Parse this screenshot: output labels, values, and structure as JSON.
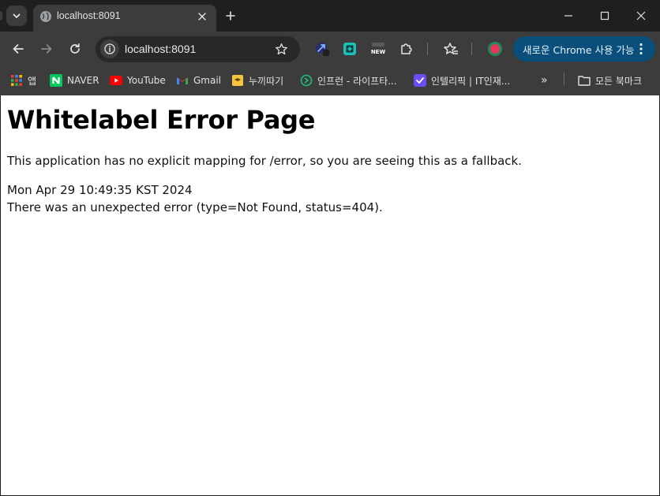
{
  "browser": {
    "tab": {
      "title": "localhost:8091"
    },
    "omnibox": {
      "url": "localhost:8091"
    },
    "update_button": {
      "label": "새로운 Chrome 사용 가능"
    },
    "bookmarks": [
      {
        "label": "앱",
        "icon": "apps-grid-icon"
      },
      {
        "label": "NAVER",
        "icon": "naver-icon"
      },
      {
        "label": "YouTube",
        "icon": "youtube-icon"
      },
      {
        "label": "Gmail",
        "icon": "gmail-icon"
      },
      {
        "label": "누끼따기",
        "icon": "folder-yellow-icon"
      },
      {
        "label": "인프런 - 라이프타...",
        "icon": "inflearn-icon"
      },
      {
        "label": "인텔리픽 | IT인재...",
        "icon": "check-purple-icon"
      }
    ],
    "bookmarks_overflow": "»",
    "all_bookmarks": {
      "label": "모든 북마크",
      "icon": "folder-icon"
    },
    "colors": {
      "chrome_dark": "#1f1f1f",
      "toolbar": "#3c3c3c",
      "update_blue": "#0a4f7c",
      "page_bg": "#ffffff"
    }
  },
  "page": {
    "heading": "Whitelabel Error Page",
    "message": "This application has no explicit mapping for /error, so you are seeing this as a fallback.",
    "timestamp": "Mon Apr 29 10:49:35 KST 2024",
    "error_detail": "There was an unexpected error (type=Not Found, status=404)."
  }
}
